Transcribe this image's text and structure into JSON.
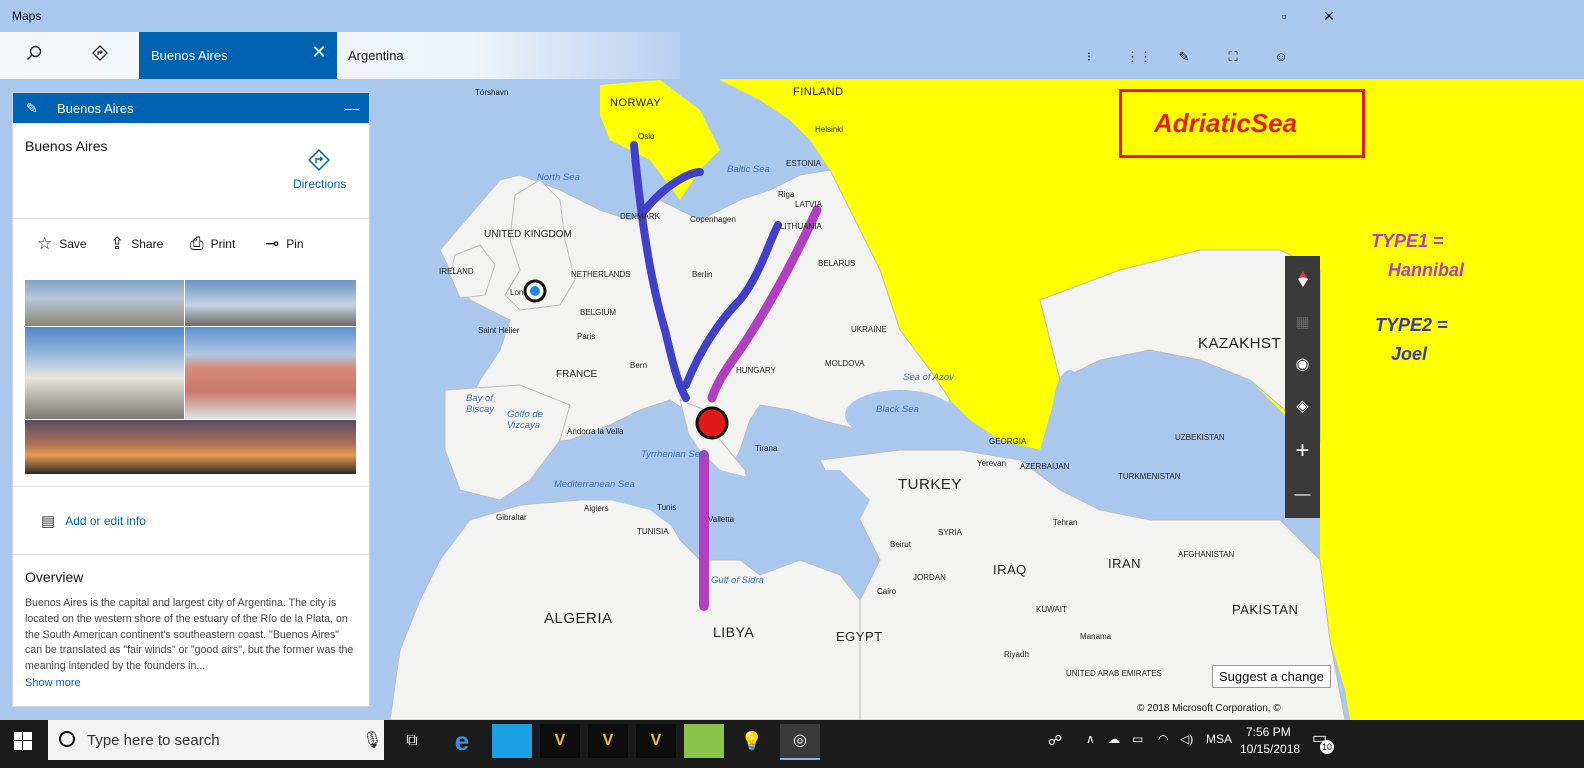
{
  "window": {
    "title": "Maps",
    "maximize_glyph": "▫",
    "close_glyph": "✕"
  },
  "toolbar": {
    "search_icon": "search-icon",
    "directions_icon": "directions-icon",
    "active_tab": {
      "label": "Buenos Aires",
      "close_glyph": "✕"
    },
    "tab2": {
      "label": "Argentina"
    },
    "right_icons": [
      "traffic-icon",
      "grid-icon",
      "ink-icon",
      "measure-icon",
      "user-icon"
    ]
  },
  "map": {
    "cities": [
      "Tórshavn",
      "Oslo",
      "Helsinki",
      "Riga",
      "Copenhagen",
      "Berlin",
      "Lon",
      "Saint Helier",
      "Paris",
      "Bern",
      "Andorra la Vella",
      "Algiers",
      "Tunis",
      "Valletta",
      "Gibraltar",
      "Tirana",
      "Yerevan",
      "Beirut",
      "Cairo",
      "Tehran",
      "Manama",
      "Riyadh"
    ],
    "countries": [
      "NORWAY",
      "FINLAND",
      "ESTONIA",
      "LATVIA",
      "LITHUANIA",
      "DENMARK",
      "UNITED KINGDOM",
      "IRELAND",
      "NETHERLANDS",
      "BELGIUM",
      "FRANCE",
      "BELARUS",
      "UKRAINE",
      "MOLDOVA",
      "HUNGARY",
      "TUNISIA",
      "SYRIA",
      "JORDAN",
      "KUWAIT",
      "GEORGIA",
      "AZERBAIJAN",
      "UZBEKISTAN",
      "TURKMENISTAN",
      "AFGHANISTAN",
      "UNITED ARAB EMIRATES"
    ],
    "big_countries": [
      "KAZAKHST",
      "TURKEY",
      "IRAQ",
      "IRAN",
      "PAKISTAN",
      "ALGERIA",
      "LIBYA",
      "EGYPT"
    ],
    "seas": [
      "North Sea",
      "Baltic Sea",
      "Bay of Biscay",
      "Golfo de Vizcaya",
      "Tyrrhenian Sea",
      "Mediterranean Sea",
      "Black Sea",
      "Sea of Azov",
      "Gulf of Sidra"
    ]
  },
  "panel": {
    "header_title": "Buenos Aires",
    "edit_icon": "pencil-icon",
    "minimize_glyph": "—",
    "place_name": "Buenos Aires",
    "directions_label": "Directions",
    "actions": [
      {
        "label": "Save",
        "icon": "☆"
      },
      {
        "label": "Share",
        "icon": "⇪"
      },
      {
        "label": "Print",
        "icon": "⎙"
      },
      {
        "label": "Pin",
        "icon": "⊸"
      }
    ],
    "add_info_label": "Add or edit info",
    "overview_title": "Overview",
    "overview_text": "Buenos Aires is the capital and largest city of Argentina. The city is located on the western shore of the estuary of the Río de la Plata, on the South American continent's southeastern coast. \"Buenos Aires\" can be translated as \"fair winds\" or \"good airs\", but the former was the meaning intended by the founders in...",
    "show_more": "Show more"
  },
  "map_controls": {
    "compass": "▾",
    "plus": "+",
    "minus": "—"
  },
  "suggest_label": "Suggest a change",
  "copyright": "© 2018 Microsoft Corporation, ©",
  "annotations": {
    "adriatic": "AdriaticSea",
    "type1_label": "TYPE1  =",
    "type1_value": "Hannibal",
    "type2_label": "TYPE2  =",
    "type2_value": "Joel",
    "type1_color": "#b040c0",
    "type2_color": "#3a3ab0",
    "box_color": "#e11111",
    "highlight": "#ffff00"
  },
  "taskbar": {
    "search_placeholder": "Type here to search",
    "tray_language": "MSA",
    "time": "7:56 PM",
    "date": "10/15/2018",
    "notifications": "10"
  }
}
